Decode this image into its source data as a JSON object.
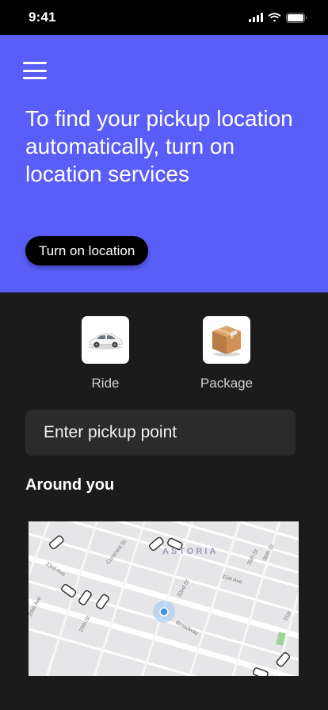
{
  "status_bar": {
    "time": "9:41"
  },
  "hero": {
    "heading": "To find your pickup location automatically, turn on location services",
    "button_label": "Turn on location",
    "background_color": "#5a5ef8"
  },
  "services": [
    {
      "label": "Ride",
      "icon": "car-icon"
    },
    {
      "label": "Package",
      "icon": "package-box-icon"
    }
  ],
  "pickup": {
    "placeholder": "Enter pickup point"
  },
  "around": {
    "heading": "Around you"
  },
  "map": {
    "neighborhood": "ASTORIA",
    "streets": [
      "23rd Ave",
      "Crescent St",
      "31st Ave",
      "32nd St",
      "Broadway",
      "35th St",
      "36th St",
      "24th Ave",
      "29th St",
      "31st"
    ]
  }
}
